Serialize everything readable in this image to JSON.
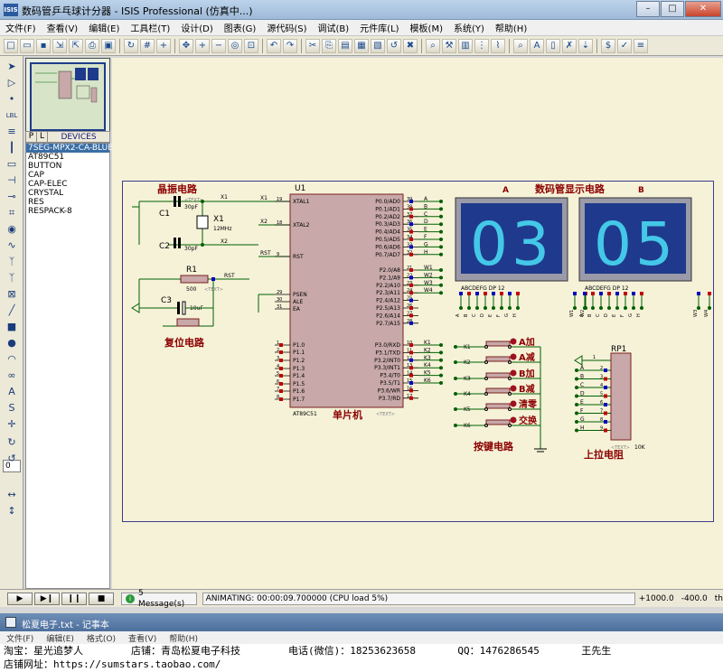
{
  "window": {
    "title": "数码管乒乓球计分器 - ISIS Professional (仿真中...)",
    "app_icon": "ISIS",
    "minimize": "–",
    "maximize": "□",
    "close": "✕"
  },
  "menu": [
    "文件(F)",
    "查看(V)",
    "编辑(E)",
    "工具栏(T)",
    "设计(D)",
    "图表(G)",
    "源代码(S)",
    "调试(B)",
    "元件库(L)",
    "模板(M)",
    "系统(Y)",
    "帮助(H)"
  ],
  "toolbar_icons": [
    "new-file-icon",
    "open-icon",
    "save-icon",
    "import-icon",
    "export-icon",
    "print-icon",
    "print-area-icon",
    "refresh-icon",
    "grid-icon",
    "origin-icon",
    "pan-icon",
    "zoom-in-icon",
    "zoom-out-icon",
    "zoom-all-icon",
    "zoom-area-icon",
    "undo-icon",
    "redo-icon",
    "cut-icon",
    "copy-icon",
    "paste-icon",
    "block-copy-icon",
    "block-move-icon",
    "block-rotate-icon",
    "block-delete-icon",
    "pick-device-icon",
    "make-device-icon",
    "package-icon",
    "decompose-icon",
    "wire-autoroute-icon",
    "search-icon",
    "property-assign-icon",
    "new-sheet-icon",
    "remove-sheet-icon",
    "zoom-child-icon",
    "bom-icon",
    "erc-icon",
    "netlist-icon"
  ],
  "left_tools": {
    "icons": [
      "select-mode-icon",
      "component-mode-icon",
      "junction-icon",
      "wire-label-icon",
      "text-script-icon",
      "bus-icon",
      "subcircuit-icon",
      "terminal-icon",
      "device-pin-icon",
      "graph-icon",
      "tape-recorder-icon",
      "generator-icon",
      "voltage-probe-icon",
      "current-probe-icon",
      "virtual-instrument-icon",
      "line-icon",
      "box-icon",
      "circle-icon",
      "arc-icon",
      "path-icon",
      "text-icon",
      "symbol-icon",
      "marker-icon",
      "rotate-cw-icon",
      "rotate-ccw-icon",
      "mirror-x-icon",
      "mirror-y-icon"
    ],
    "rotation_value": "0"
  },
  "device_panel": {
    "tab_p": "P",
    "tab_l": "L",
    "header": "DEVICES",
    "selected_index": 0,
    "items": [
      "7SEG-MPX2-CA-BLUE",
      "AT89C51",
      "BUTTON",
      "CAP",
      "CAP-ELEC",
      "CRYSTAL",
      "RES",
      "RESPACK-8"
    ]
  },
  "schematic": {
    "labels": {
      "crystal_circuit": "晶振电路",
      "reset_circuit": "复位电路",
      "mcu": "单片机",
      "display_title": "数码管显示电路",
      "display_a": "A",
      "display_b": "B",
      "keys_title": "按键电路",
      "pullup_title": "上拉电阻"
    },
    "u1": {
      "ref": "U1",
      "part": "AT89C51",
      "text_tag": "<TEXT>",
      "left_pins": [
        {
          "num": "19",
          "name": "XTAL1"
        },
        {
          "num": "18",
          "name": "XTAL2"
        },
        {
          "num": "9",
          "name": "RST"
        },
        {
          "num": "29",
          "name": "PSEN"
        },
        {
          "num": "30",
          "name": "ALE"
        },
        {
          "num": "31",
          "name": "EA"
        },
        {
          "num": "1",
          "name": "P1.0"
        },
        {
          "num": "2",
          "name": "P1.1"
        },
        {
          "num": "3",
          "name": "P1.2"
        },
        {
          "num": "4",
          "name": "P1.3"
        },
        {
          "num": "5",
          "name": "P1.4"
        },
        {
          "num": "6",
          "name": "P1.5"
        },
        {
          "num": "7",
          "name": "P1.6"
        },
        {
          "num": "8",
          "name": "P1.7"
        }
      ],
      "right_pins": [
        {
          "num": "39",
          "name": "P0.0/AD0",
          "net": "A"
        },
        {
          "num": "38",
          "name": "P0.1/AD1",
          "net": "B"
        },
        {
          "num": "37",
          "name": "P0.2/AD2",
          "net": "C"
        },
        {
          "num": "36",
          "name": "P0.3/AD3",
          "net": "D"
        },
        {
          "num": "35",
          "name": "P0.4/AD4",
          "net": "E"
        },
        {
          "num": "34",
          "name": "P0.5/AD5",
          "net": "F"
        },
        {
          "num": "33",
          "name": "P0.6/AD6",
          "net": "G"
        },
        {
          "num": "32",
          "name": "P0.7/AD7",
          "net": "H"
        },
        {
          "num": "21",
          "name": "P2.0/A8",
          "net": "W1"
        },
        {
          "num": "22",
          "name": "P2.1/A9",
          "net": "W2"
        },
        {
          "num": "23",
          "name": "P2.2/A10",
          "net": "W3"
        },
        {
          "num": "24",
          "name": "P2.3/A11",
          "net": "W4"
        },
        {
          "num": "25",
          "name": "P2.4/A12",
          "net": ""
        },
        {
          "num": "26",
          "name": "P2.5/A13",
          "net": ""
        },
        {
          "num": "27",
          "name": "P2.6/A14",
          "net": ""
        },
        {
          "num": "28",
          "name": "P2.7/A15",
          "net": ""
        },
        {
          "num": "10",
          "name": "P3.0/RXD",
          "net": "K1"
        },
        {
          "num": "11",
          "name": "P3.1/TXD",
          "net": "K2"
        },
        {
          "num": "12",
          "name": "P3.2/INT0",
          "net": "K3"
        },
        {
          "num": "13",
          "name": "P3.3/INT1",
          "net": "K4"
        },
        {
          "num": "14",
          "name": "P3.4/T0",
          "net": "K5"
        },
        {
          "num": "15",
          "name": "P3.5/T1",
          "net": "K6"
        },
        {
          "num": "16",
          "name": "P3.6/WR",
          "net": ""
        },
        {
          "num": "17",
          "name": "P3.7/RD",
          "net": ""
        }
      ]
    },
    "crystal": {
      "c1": "C1",
      "c1_val": "30pF",
      "c2": "C2",
      "c2_val": "30pF",
      "x1": "X1",
      "x1_val": "12MHz",
      "text_tag": "<TEXT>",
      "net_x1": "X1",
      "net_x2": "X2",
      "rst": "RST"
    },
    "reset": {
      "r1": "R1",
      "r1_val": "500",
      "c3": "C3",
      "c3_val": "10uF",
      "text_tag": "<TEXT>",
      "net": "RST"
    },
    "display_a": {
      "digits": "03",
      "pins": "ABCDEFG  DP      12",
      "nets": [
        "A",
        "B",
        "C",
        "D",
        "E",
        "F",
        "G",
        "H",
        "W1",
        "W2"
      ]
    },
    "display_b": {
      "digits": "05",
      "pins": "ABCDEFG  DP      12",
      "nets": [
        "A",
        "B",
        "C",
        "D",
        "E",
        "F",
        "G",
        "H",
        "W3",
        "W4"
      ]
    },
    "keys": [
      {
        "net": "K1",
        "label": "A加"
      },
      {
        "net": "K2",
        "label": "A减"
      },
      {
        "net": "K3",
        "label": "B加"
      },
      {
        "net": "K4",
        "label": "B减"
      },
      {
        "net": "K5",
        "label": "清零"
      },
      {
        "net": "K6",
        "label": "交换"
      }
    ],
    "respack": {
      "ref": "RP1",
      "value": "10K",
      "text_tag": "<TEXT>",
      "nets": [
        "A",
        "B",
        "C",
        "D",
        "E",
        "F",
        "G",
        "H"
      ],
      "pins": [
        "2",
        "3",
        "4",
        "5",
        "6",
        "7",
        "8",
        "9"
      ],
      "pin1": "1"
    },
    "colors": {
      "wire": "#006000",
      "body": "#c8a8a8",
      "body_border": "#7a2020",
      "label_red": "#8b0000",
      "display_bg": "#1f3a8c",
      "segment": "#44c8e8",
      "pin_red": "#c00000",
      "pin_blue": "#0000c0"
    }
  },
  "statusbar": {
    "play": "▶",
    "step": "▶❙",
    "pause": "❙❙",
    "stop": "■",
    "messages": "5 Message(s)",
    "animating": "ANIMATING: 00:00:09.700000 (CPU load 5%)",
    "coord_x": "+1000.0",
    "coord_y": "-400.0",
    "coord_unit": "th"
  },
  "notepad": {
    "title": "松夏电子.txt - 记事本",
    "menu": [
      "文件(F)",
      "编辑(E)",
      "格式(O)",
      "查看(V)",
      "帮助(H)"
    ],
    "lines": [
      "淘宝：星光追梦人        店铺：青岛松夏电子科技        电话(微信)：18253623658       QQ：1476286545       王先生",
      "店铺网址：https://sumstars.taobao.com/"
    ]
  }
}
